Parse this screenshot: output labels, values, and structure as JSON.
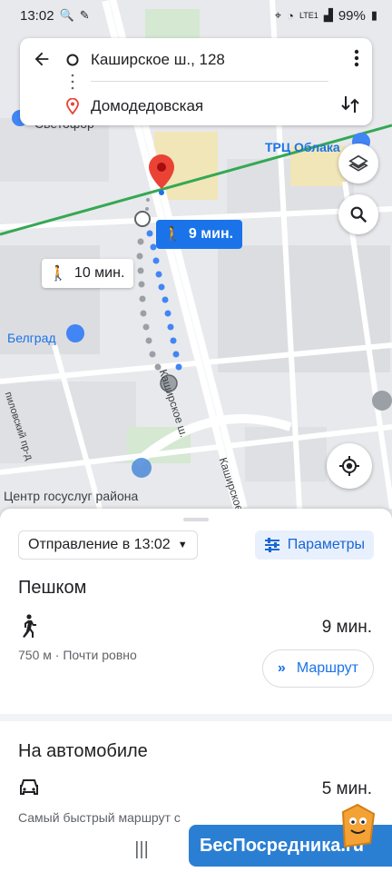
{
  "status_bar": {
    "time": "13:02",
    "battery": "99%",
    "network": "LTE1"
  },
  "directions": {
    "origin": "Каширское ш., 128",
    "destination": "Домодедовская"
  },
  "map": {
    "labels": {
      "svetofor": "Светофор",
      "trc": "ТРЦ Облака",
      "belgrad": "Белград",
      "street_kashirskoe_1": "Каширское ш.",
      "street_kashirskoe_2": "Каширское ш.",
      "street_pilovsky": "пиловский пр-д",
      "center_gosuslug": "Центр госуслуг района"
    },
    "tag_fast": "9 мин.",
    "tag_alt": "10 мин."
  },
  "sheet": {
    "departure": "Отправление в 13:02",
    "params": "Параметры",
    "walk": {
      "title": "Пешком",
      "time": "9 мин.",
      "desc": "750 м · Почти ровно",
      "route_label": "Маршрут"
    },
    "car": {
      "title": "На автомобиле",
      "time": "5 мин.",
      "desc": "Самый быстрый маршрут с"
    }
  },
  "watermark": "БесПосредника.ru",
  "colors": {
    "accent": "#1a73e8",
    "pin": "#ea4335",
    "rail": "#34a853"
  }
}
